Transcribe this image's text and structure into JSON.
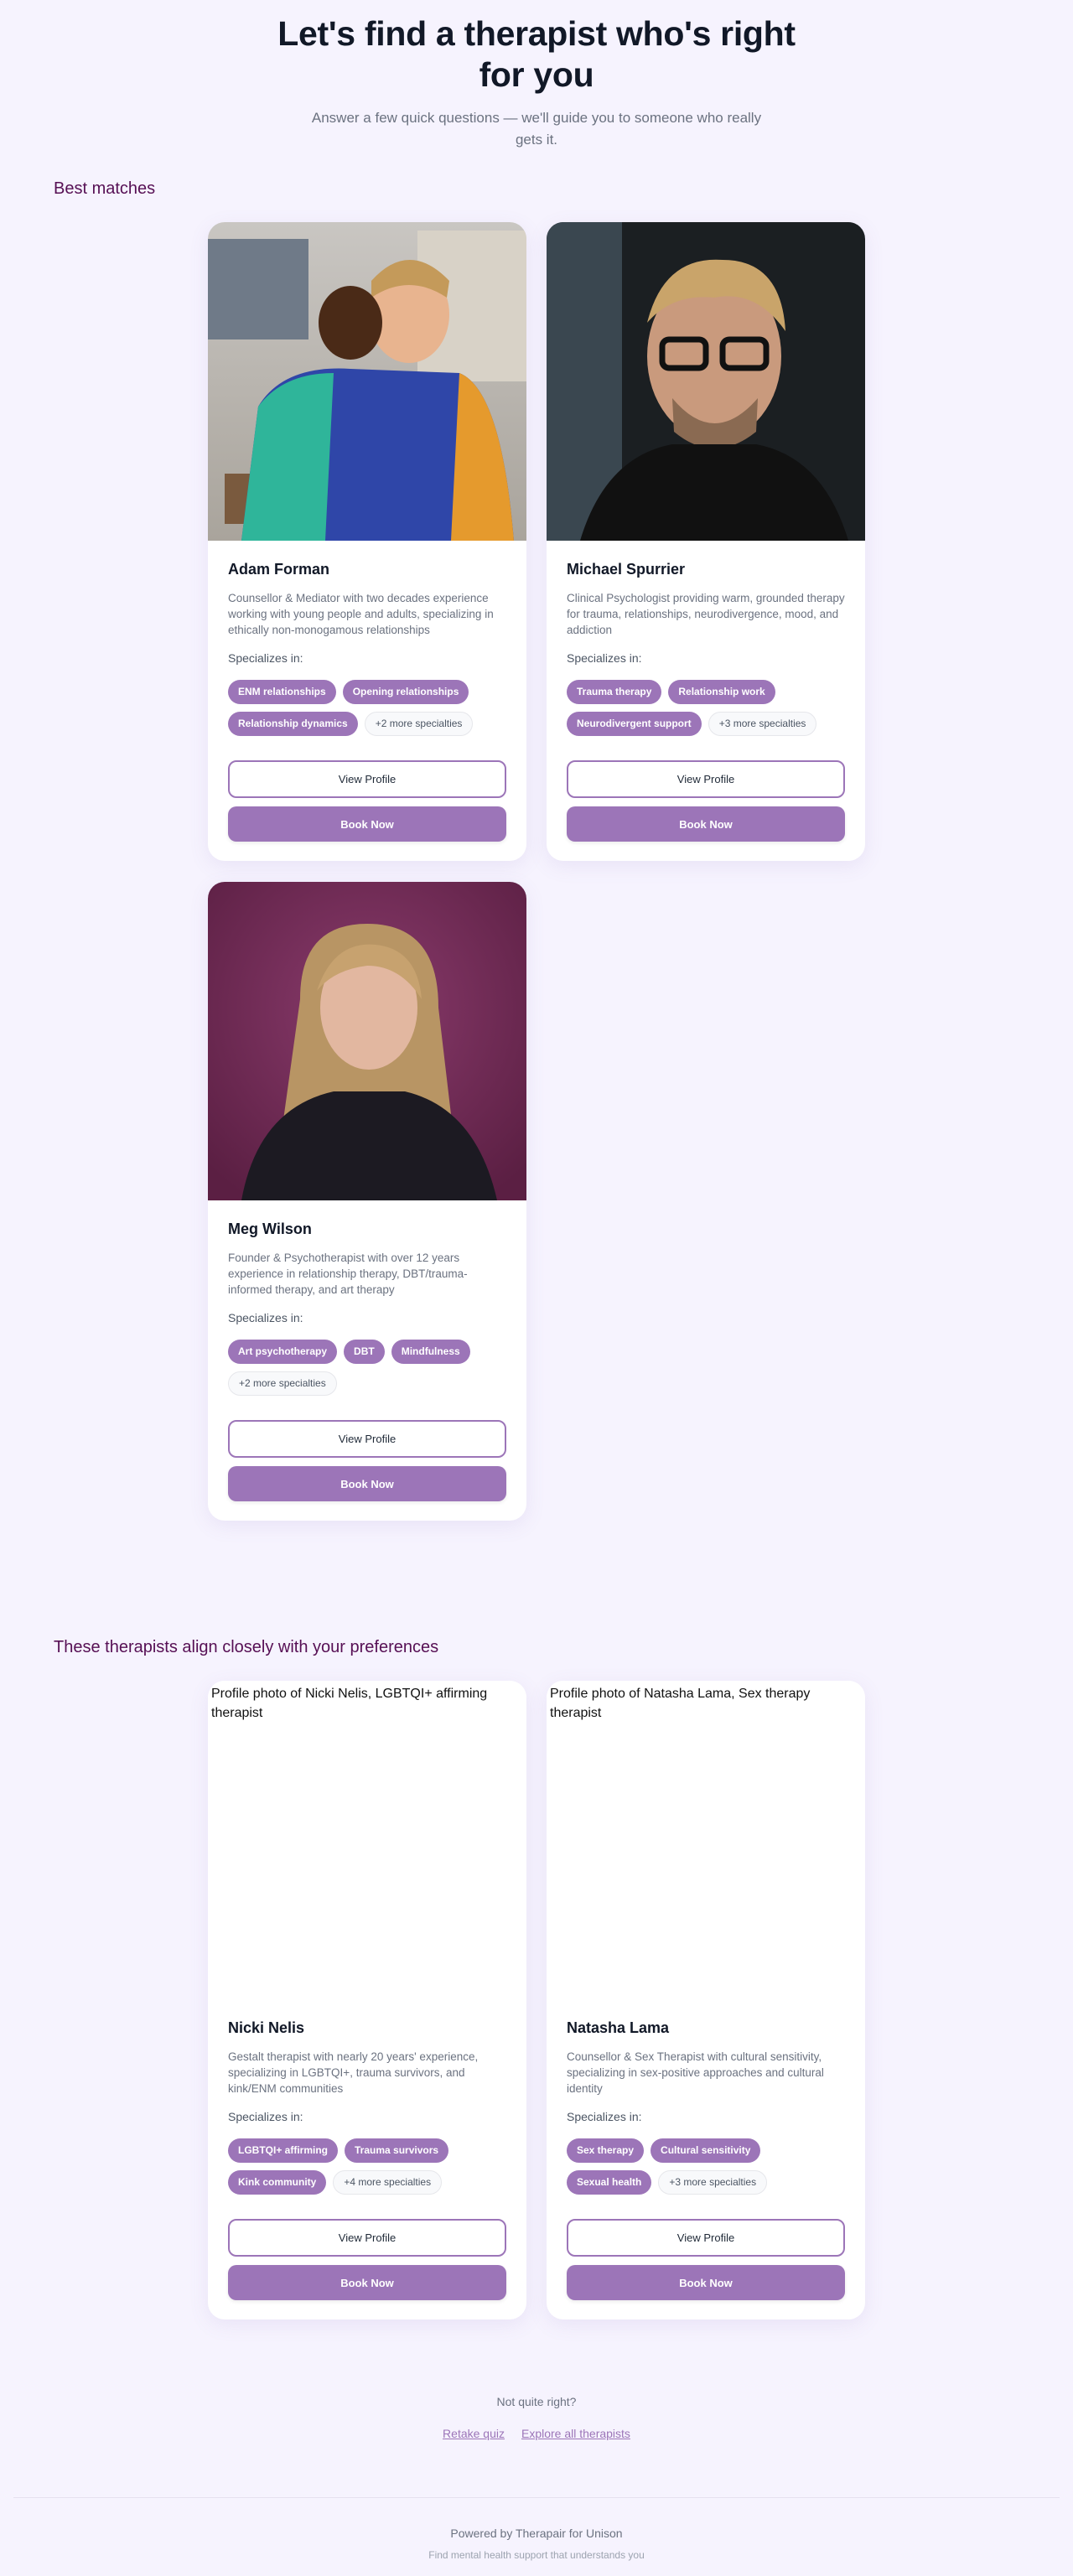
{
  "hero": {
    "title": "Let's find a therapist who's right for you",
    "subtitle": "Answer a few quick questions — we'll guide you to someone who really gets it."
  },
  "sections": [
    {
      "title": "Best matches",
      "therapists": [
        {
          "name": "Adam Forman",
          "photo": "adam",
          "description": "Counsellor & Mediator with two decades experience working with young people and adults, specializing in ethically non-monogamous relationships",
          "specializes_label": "Specializes in:",
          "tags": [
            "ENM relationships",
            "Opening relationships",
            "Relationship dynamics"
          ],
          "more": "+2 more specialties",
          "view_label": "View Profile",
          "book_label": "Book Now"
        },
        {
          "name": "Michael Spurrier",
          "photo": "michael",
          "description": "Clinical Psychologist providing warm, grounded therapy for trauma, relationships, neurodivergence, mood, and addiction",
          "specializes_label": "Specializes in:",
          "tags": [
            "Trauma therapy",
            "Relationship work",
            "Neurodivergent support"
          ],
          "more": "+3 more specialties",
          "view_label": "View Profile",
          "book_label": "Book Now"
        },
        {
          "name": "Meg Wilson",
          "photo": "meg",
          "description": "Founder & Psychotherapist with over 12 years experience in relationship therapy, DBT/trauma-informed therapy, and art therapy",
          "specializes_label": "Specializes in:",
          "tags": [
            "Art psychotherapy",
            "DBT",
            "Mindfulness"
          ],
          "more": "+2 more specialties",
          "view_label": "View Profile",
          "book_label": "Book Now"
        }
      ]
    },
    {
      "title": "These therapists align closely with your preferences",
      "therapists": [
        {
          "name": "Nicki Nelis",
          "photo_alt": "Profile photo of Nicki Nelis, LGBTQI+ affirming therapist",
          "description": "Gestalt therapist with nearly 20 years' experience, specializing in LGBTQI+, trauma survivors, and kink/ENM communities",
          "specializes_label": "Specializes in:",
          "tags": [
            "LGBTQI+ affirming",
            "Trauma survivors",
            "Kink community"
          ],
          "more": "+4 more specialties",
          "view_label": "View Profile",
          "book_label": "Book Now"
        },
        {
          "name": "Natasha Lama",
          "photo_alt": "Profile photo of Natasha Lama, Sex therapy therapist",
          "description": "Counsellor & Sex Therapist with cultural sensitivity, specializing in sex-positive approaches and cultural identity",
          "specializes_label": "Specializes in:",
          "tags": [
            "Sex therapy",
            "Cultural sensitivity",
            "Sexual health"
          ],
          "more": "+3 more specialties",
          "view_label": "View Profile",
          "book_label": "Book Now"
        }
      ]
    }
  ],
  "footer_cta": {
    "question": "Not quite right?",
    "retake": "Retake quiz",
    "explore": "Explore all therapists"
  },
  "footer": {
    "powered": "Powered by Therapair for Unison",
    "tagline": "Find mental health support that understands you"
  },
  "colors": {
    "accent": "#9c75b8",
    "heading": "#560f54",
    "background": "#f6f3fe"
  }
}
